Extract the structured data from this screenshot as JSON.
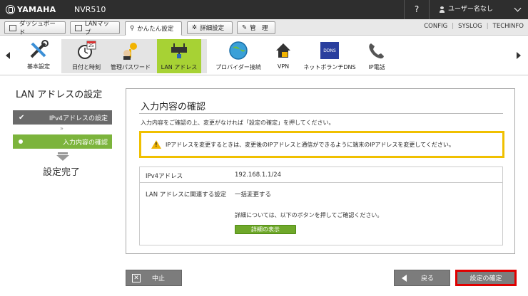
{
  "header": {
    "brand": "YAMAHA",
    "model": "NVR510",
    "help": "?",
    "user": "ユーザー名なし"
  },
  "nav": {
    "tabs": [
      {
        "label": "ダッシュボード"
      },
      {
        "label": "LANマップ"
      },
      {
        "label": "かんたん設定"
      },
      {
        "label": "詳細設定"
      },
      {
        "label": "管　理"
      }
    ],
    "links": [
      "CONFIG",
      "SYSLOG",
      "TECHINFO"
    ]
  },
  "iconbar": {
    "basic": "基本設定",
    "items": [
      {
        "label": "日付と時刻"
      },
      {
        "label": "管理パスワード"
      },
      {
        "label": "LAN アドレス"
      },
      {
        "label": "プロバイダー接続"
      },
      {
        "label": "VPN"
      },
      {
        "label": "ネットボランチDNS"
      },
      {
        "label": "IP電話"
      }
    ],
    "calendar_day": "25"
  },
  "wizard": {
    "title": "LAN アドレスの設定",
    "step1": "IPv4アドレスの設定",
    "step2": "入力内容の確認",
    "done": "設定完了"
  },
  "panel": {
    "title": "入力内容の確認",
    "desc": "入力内容をご確認の上、変更がなければ「設定の確定」を押してください。",
    "warning": "IPアドレスを変更するときは、変更後のIPアドレスと通信ができるように端末のIPアドレスを変更してください。",
    "rows": [
      {
        "label": "IPv4アドレス",
        "value": "192.168.1.1/24"
      },
      {
        "label": "LAN アドレスに関連する設定",
        "value": "一括変更する"
      }
    ],
    "detail_note": "詳細については、以下のボタンを押してご確認ください。",
    "detail_button": "詳細の表示"
  },
  "footer": {
    "cancel": "中止",
    "back": "戻る",
    "confirm": "設定の確定"
  }
}
